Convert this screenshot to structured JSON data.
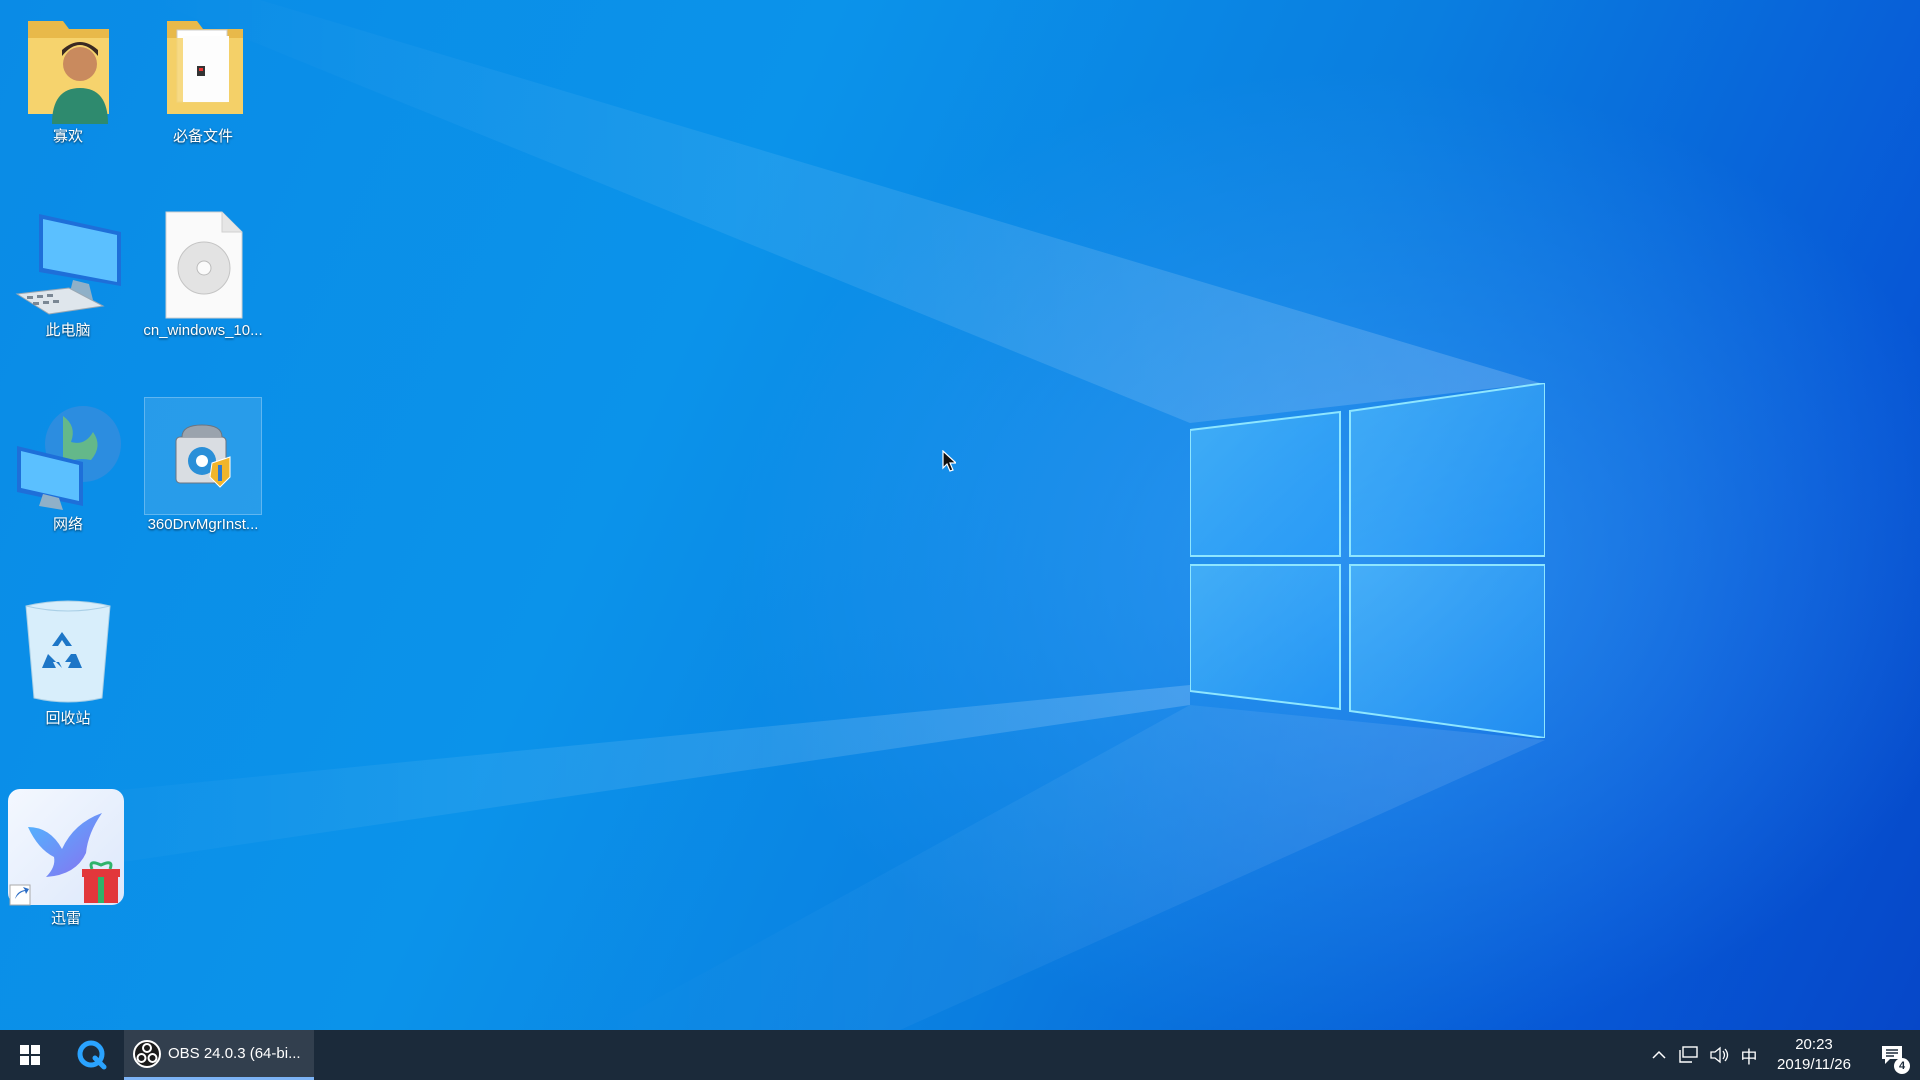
{
  "desktop": {
    "icons": [
      {
        "label": "寡欢",
        "icon": "user-folder-icon"
      },
      {
        "label": "必备文件",
        "icon": "folder-icon"
      },
      {
        "label": "此电脑",
        "icon": "this-pc-icon"
      },
      {
        "label": "cn_windows_10...",
        "icon": "disc-image-file-icon"
      },
      {
        "label": "网络",
        "icon": "network-icon"
      },
      {
        "label": "360DrvMgrInst...",
        "icon": "installer-icon"
      },
      {
        "label": "回收站",
        "icon": "recycle-bin-icon"
      },
      {
        "label": "迅雷",
        "icon": "xunlei-bird-icon"
      }
    ]
  },
  "taskbar": {
    "running_app": {
      "title": "OBS 24.0.3 (64-bi...",
      "icon": "obs-icon"
    },
    "tray": {
      "ime": "中",
      "time": "20:23",
      "date": "2019/11/26",
      "notification_count": "4"
    }
  },
  "colors": {
    "desktop_blue": "#0a8be6",
    "taskbar": "#1b2a3a",
    "accent": "#7cb3f5"
  }
}
